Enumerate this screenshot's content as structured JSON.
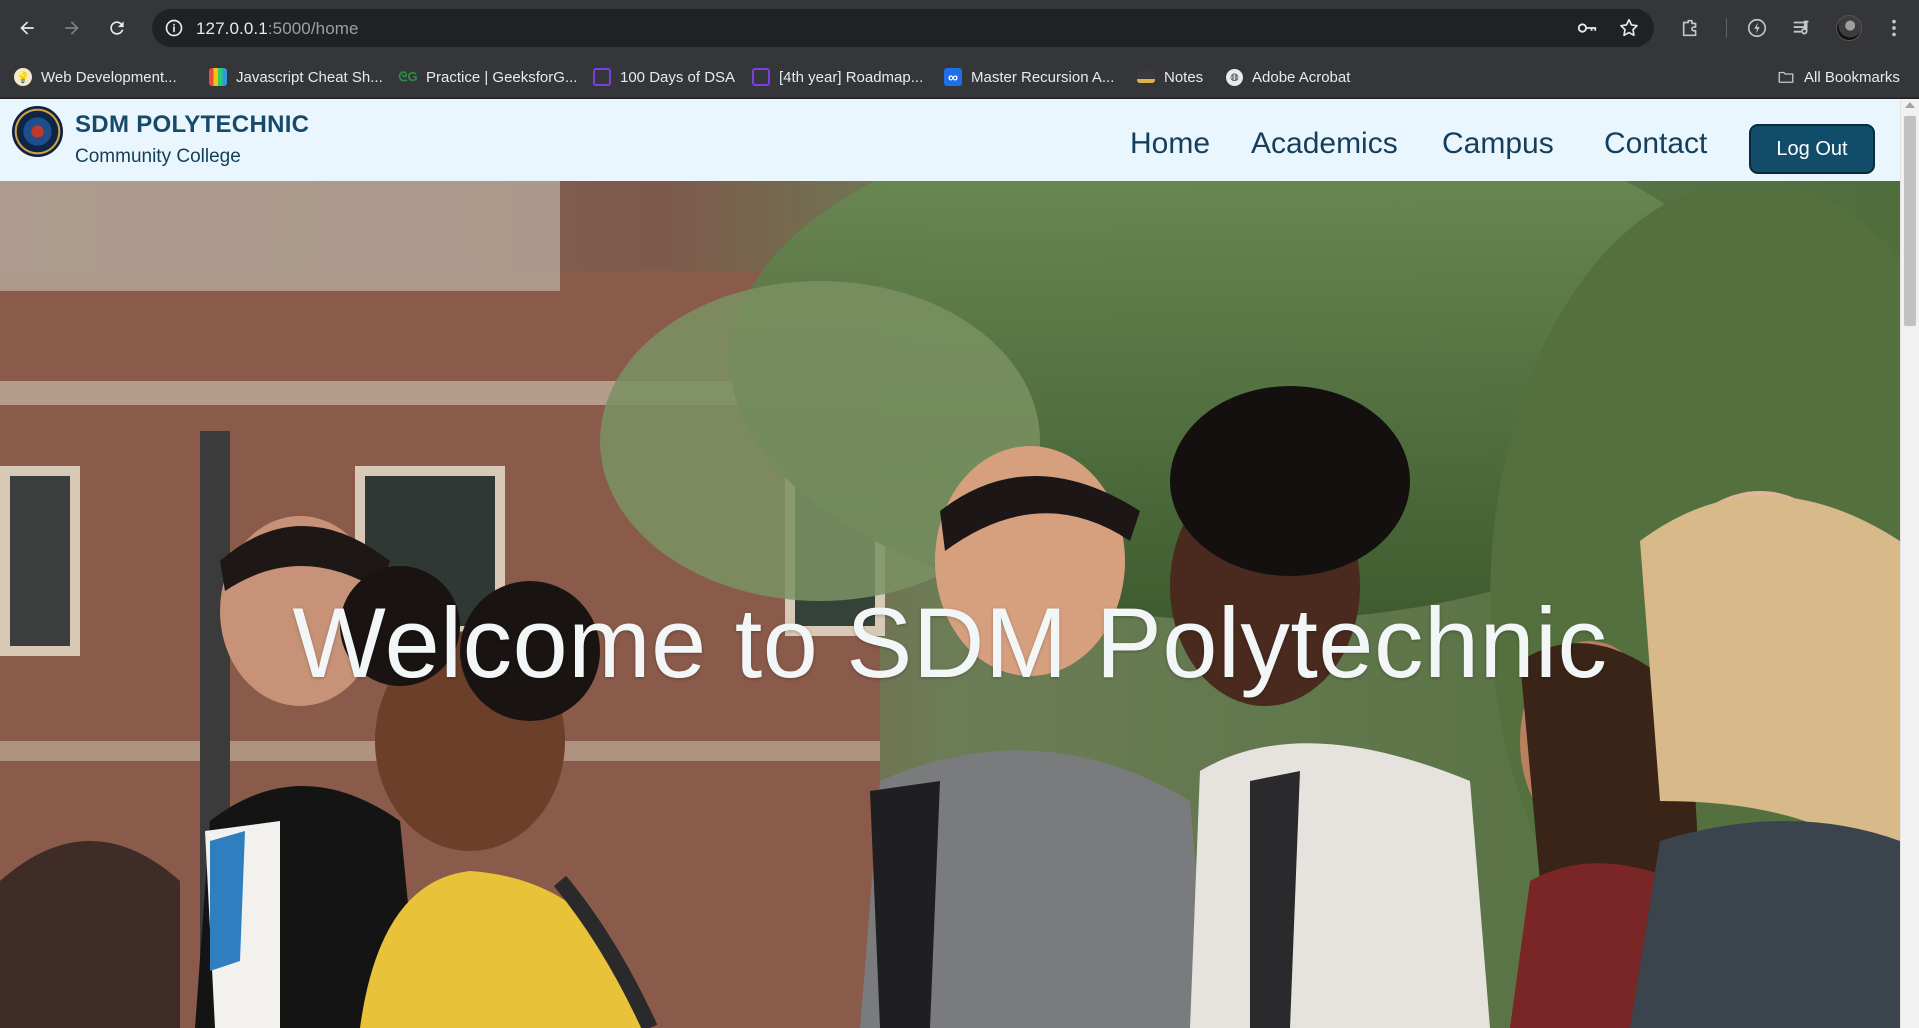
{
  "browser": {
    "url_host": "127.0.0.1",
    "url_path": ":5000/home",
    "icons": [
      "back-arrow-icon",
      "forward-arrow-icon",
      "reload-icon",
      "site-info-icon",
      "password-key-icon",
      "bookmark-star-icon",
      "extensions-icon",
      "performance-icon",
      "media-controls-icon",
      "profile-avatar",
      "menu-kebab-icon"
    ]
  },
  "bookmarks": {
    "items": [
      {
        "label": "Web Development...",
        "icon": "bulb-favicon",
        "color": "#f5e9c8"
      },
      {
        "label": "Javascript Cheat Sh...",
        "icon": "stripes-favicon",
        "color": "#e0b84a"
      },
      {
        "label": "Practice | GeeksforG...",
        "icon": "gfg-favicon",
        "color": "#2f8d46"
      },
      {
        "label": "100 Days of DSA",
        "icon": "purple-box-favicon",
        "color": "#7b3fe4"
      },
      {
        "label": "[4th year] Roadmap...",
        "icon": "purple-box-favicon",
        "color": "#7b3fe4"
      },
      {
        "label": "Master Recursion A...",
        "icon": "infinity-favicon",
        "color": "#1e6fe8"
      },
      {
        "label": "Notes",
        "icon": "notes-favicon",
        "color": "#d9b44a"
      },
      {
        "label": "Adobe Acrobat",
        "icon": "globe-favicon",
        "color": "#e8eaed"
      }
    ],
    "all_bookmarks": "All Bookmarks"
  },
  "site": {
    "brand_name": "SDM POLYTECHNIC",
    "brand_sub": "Community College",
    "nav": {
      "home": "Home",
      "academics": "Academics",
      "campus": "Campus",
      "contact": "Contact"
    },
    "logout": "Log Out",
    "hero_title": "Welcome to SDM Polytechnic",
    "accent_color": "#114c6a"
  }
}
